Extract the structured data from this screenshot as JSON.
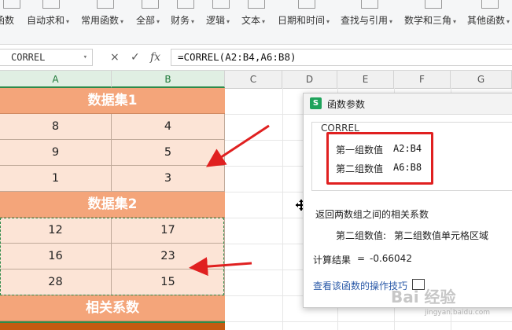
{
  "ribbon": {
    "groups": [
      {
        "label": "函数",
        "dropdown": false
      },
      {
        "label": "自动求和",
        "dropdown": true
      },
      {
        "label": "常用函数",
        "dropdown": true
      },
      {
        "label": "全部",
        "dropdown": true
      },
      {
        "label": "财务",
        "dropdown": true
      },
      {
        "label": "逻辑",
        "dropdown": true
      },
      {
        "label": "文本",
        "dropdown": true
      },
      {
        "label": "日期和时间",
        "dropdown": true
      },
      {
        "label": "查找与引用",
        "dropdown": true
      },
      {
        "label": "数学和三角",
        "dropdown": true
      },
      {
        "label": "其他函数",
        "dropdown": true
      }
    ]
  },
  "formula_bar": {
    "name_box": "CORREL",
    "cancel_symbol": "×",
    "confirm_symbol": "✓",
    "fx_symbol": "fx",
    "formula": "=CORREL(A2:B4,A6:B8)"
  },
  "columns": [
    "A",
    "B",
    "C",
    "D",
    "E",
    "F",
    "G"
  ],
  "sheet": {
    "dataset1_title": "数据集1",
    "dataset1_rows": [
      [
        "8",
        "4"
      ],
      [
        "9",
        "5"
      ],
      [
        "1",
        "3"
      ]
    ],
    "dataset2_title": "数据集2",
    "dataset2_rows": [
      [
        "12",
        "17"
      ],
      [
        "16",
        "23"
      ],
      [
        "28",
        "15"
      ]
    ],
    "correlation_title": "相关系数"
  },
  "dialog": {
    "title": "函数参数",
    "logo_letter": "S",
    "function_name": "CORREL",
    "arg1_label": "第一组数值",
    "arg1_value": "A2:B4",
    "arg2_label": "第二组数值",
    "arg2_value": "A6:B8",
    "description": "返回两数组之间的相关系数",
    "arg_help_name": "第二组数值:",
    "arg_help_text": "第二组数值单元格区域",
    "result_label": "计算结果",
    "result_equals": "=",
    "result_value": "-0.66042",
    "help_link": "查看该函数的操作技巧"
  },
  "watermark": {
    "text": "Bai 经验",
    "url": "jingyan.baidu.com"
  },
  "colors": {
    "header_fill": "#f4a57a",
    "cell_fill": "#fce4d6",
    "annotation_red": "#e02020",
    "selection_green": "#2e8b4a"
  }
}
